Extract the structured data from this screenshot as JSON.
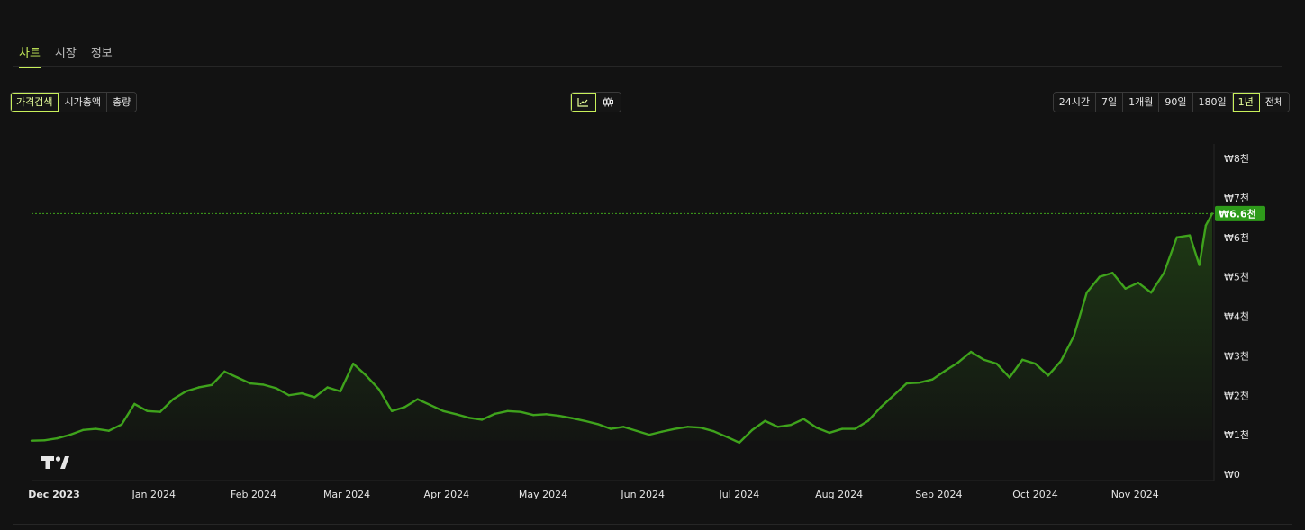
{
  "tabs": [
    {
      "label": "차트",
      "active": true
    },
    {
      "label": "시장",
      "active": false
    },
    {
      "label": "정보",
      "active": false
    }
  ],
  "metric_buttons": [
    {
      "label": "가격검색",
      "active": true
    },
    {
      "label": "시가총액",
      "active": false
    },
    {
      "label": "총량",
      "active": false
    }
  ],
  "chart_type_buttons": [
    {
      "icon": "line-chart-icon",
      "active": true
    },
    {
      "icon": "candlestick-icon",
      "active": false
    }
  ],
  "range_buttons": [
    {
      "label": "24시간",
      "active": false
    },
    {
      "label": "7일",
      "active": false
    },
    {
      "label": "1개월",
      "active": false
    },
    {
      "label": "90일",
      "active": false
    },
    {
      "label": "180일",
      "active": false
    },
    {
      "label": "1년",
      "active": true
    },
    {
      "label": "전체",
      "active": false
    }
  ],
  "colors": {
    "accent": "#c8f05a",
    "up": "#3fa31c",
    "down": "#e5484d",
    "price_tag": "#2e9a1a"
  },
  "chart_data": {
    "type": "line",
    "x": [
      "2023-11-24",
      "2023-11-28",
      "2023-12-02",
      "2023-12-06",
      "2023-12-10",
      "2023-12-14",
      "2023-12-18",
      "2023-12-22",
      "2023-12-26",
      "2023-12-30",
      "2024-01-03",
      "2024-01-07",
      "2024-01-11",
      "2024-01-15",
      "2024-01-19",
      "2024-01-23",
      "2024-01-27",
      "2024-01-31",
      "2024-02-04",
      "2024-02-08",
      "2024-02-12",
      "2024-02-16",
      "2024-02-20",
      "2024-02-24",
      "2024-02-28",
      "2024-03-03",
      "2024-03-07",
      "2024-03-11",
      "2024-03-15",
      "2024-03-19",
      "2024-03-23",
      "2024-03-27",
      "2024-03-31",
      "2024-04-04",
      "2024-04-08",
      "2024-04-12",
      "2024-04-16",
      "2024-04-20",
      "2024-04-24",
      "2024-04-28",
      "2024-05-02",
      "2024-05-06",
      "2024-05-10",
      "2024-05-14",
      "2024-05-18",
      "2024-05-22",
      "2024-05-26",
      "2024-05-30",
      "2024-06-03",
      "2024-06-07",
      "2024-06-11",
      "2024-06-15",
      "2024-06-19",
      "2024-06-23",
      "2024-06-27",
      "2024-07-01",
      "2024-07-05",
      "2024-07-09",
      "2024-07-13",
      "2024-07-17",
      "2024-07-21",
      "2024-07-25",
      "2024-07-29",
      "2024-08-02",
      "2024-08-06",
      "2024-08-10",
      "2024-08-14",
      "2024-08-18",
      "2024-08-22",
      "2024-08-26",
      "2024-08-30",
      "2024-09-03",
      "2024-09-07",
      "2024-09-11",
      "2024-09-15",
      "2024-09-19",
      "2024-09-23",
      "2024-09-27",
      "2024-10-01",
      "2024-10-05",
      "2024-10-09",
      "2024-10-13",
      "2024-10-17",
      "2024-10-21",
      "2024-10-25",
      "2024-10-29",
      "2024-11-02",
      "2024-11-06",
      "2024-11-10",
      "2024-11-14",
      "2024-11-18",
      "2024-11-21",
      "2024-11-23",
      "2024-11-25"
    ],
    "values": [
      850,
      860,
      910,
      1000,
      1120,
      1150,
      1100,
      1260,
      1780,
      1600,
      1580,
      1900,
      2100,
      2200,
      2260,
      2600,
      2450,
      2300,
      2270,
      2180,
      2000,
      2050,
      1950,
      2200,
      2100,
      2800,
      2500,
      2150,
      1600,
      1700,
      1900,
      1750,
      1600,
      1520,
      1430,
      1380,
      1530,
      1600,
      1580,
      1500,
      1520,
      1480,
      1420,
      1350,
      1270,
      1150,
      1200,
      1100,
      1000,
      1080,
      1150,
      1200,
      1180,
      1090,
      950,
      800,
      1120,
      1350,
      1200,
      1250,
      1400,
      1180,
      1050,
      1150,
      1150,
      1350,
      1700,
      2000,
      2300,
      2320,
      2400,
      2620,
      2830,
      3100,
      2900,
      2800,
      2450,
      2900,
      2800,
      2500,
      2870,
      3500,
      4600,
      5000,
      5100,
      4700,
      4850,
      4600,
      5100,
      6000,
      6050,
      5300,
      6300,
      6600
    ],
    "ylim": [
      0,
      8000
    ],
    "y_ticks": [
      "₩0",
      "₩1천",
      "₩2천",
      "₩3천",
      "₩4천",
      "₩5천",
      "₩6천",
      "₩7천",
      "₩8천"
    ],
    "x_ticks": [
      {
        "label": "Dec 2023",
        "date": "2023-12-01",
        "bold": true
      },
      {
        "label": "Jan 2024",
        "date": "2024-01-01",
        "bold": false
      },
      {
        "label": "Feb 2024",
        "date": "2024-02-01",
        "bold": false
      },
      {
        "label": "Mar 2024",
        "date": "2024-03-01",
        "bold": false
      },
      {
        "label": "Apr 2024",
        "date": "2024-04-01",
        "bold": false
      },
      {
        "label": "May 2024",
        "date": "2024-05-01",
        "bold": false
      },
      {
        "label": "Jun 2024",
        "date": "2024-06-01",
        "bold": false
      },
      {
        "label": "Jul 2024",
        "date": "2024-07-01",
        "bold": false
      },
      {
        "label": "Aug 2024",
        "date": "2024-08-01",
        "bold": false
      },
      {
        "label": "Sep 2024",
        "date": "2024-09-01",
        "bold": false
      },
      {
        "label": "Oct 2024",
        "date": "2024-10-01",
        "bold": false
      },
      {
        "label": "Nov 2024",
        "date": "2024-11-01",
        "bold": false
      }
    ],
    "current_price": 6600,
    "current_price_label": "₩6.6천",
    "baseline_value": 850,
    "grid": false,
    "watermark": "TV"
  }
}
